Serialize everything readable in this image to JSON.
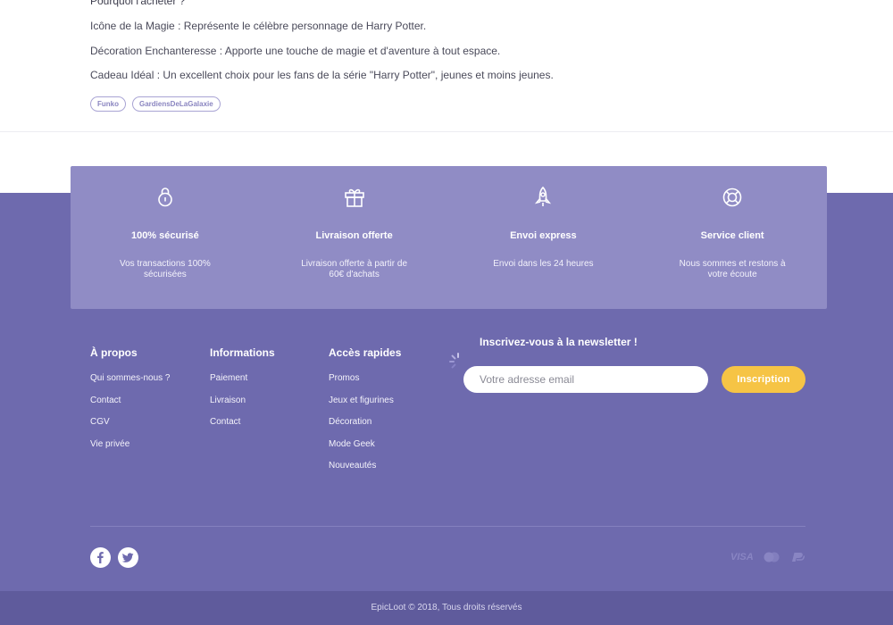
{
  "product": {
    "heading": "Pourquoi l'acheter ?",
    "lines": [
      "Icône de la Magie : Représente le célèbre personnage de Harry Potter.",
      "Décoration Enchanteresse : Apporte une touche de magie et d'aventure à tout espace.",
      "Cadeau Idéal : Un excellent choix pour les fans de la série \"Harry Potter\", jeunes et moins jeunes."
    ],
    "tags": [
      "Funko",
      "GardiensDeLaGalaxie"
    ]
  },
  "features": [
    {
      "icon": "padlock-icon",
      "title": "100% sécurisé",
      "text": "Vos transactions 100% sécurisées"
    },
    {
      "icon": "gift-icon",
      "title": "Livraison offerte",
      "text": "Livraison offerte à partir de 60€ d'achats"
    },
    {
      "icon": "rocket-icon",
      "title": "Envoi express",
      "text": "Envoi dans les 24 heures"
    },
    {
      "icon": "lifebuoy-icon",
      "title": "Service client",
      "text": "Nous sommes et restons à votre écoute"
    }
  ],
  "columns": [
    {
      "title": "À propos",
      "links": [
        "Qui sommes-nous ?",
        "Contact",
        "CGV",
        "Vie privée"
      ]
    },
    {
      "title": "Informations",
      "links": [
        "Paiement",
        "Livraison",
        "Contact"
      ]
    },
    {
      "title": "Accès rapides",
      "links": [
        "Promos",
        "Jeux et figurines",
        "Décoration",
        "Mode Geek",
        "Nouveautés"
      ]
    }
  ],
  "newsletter": {
    "title": "Inscrivez-vous à la newsletter !",
    "placeholder": "Votre adresse email",
    "button": "Inscription"
  },
  "social": [
    "facebook-icon",
    "twitter-icon"
  ],
  "payments": {
    "visa": "VISA",
    "icons": [
      "mastercard-icon",
      "paypal-icon"
    ]
  },
  "copyright": "EpicLoot © 2018, Tous droits réservés",
  "colors": {
    "footer_bg": "#6e6aae",
    "features_bg": "#908cc5",
    "bottom_bar": "#5f5b9c",
    "accent_button": "#f6c445"
  }
}
